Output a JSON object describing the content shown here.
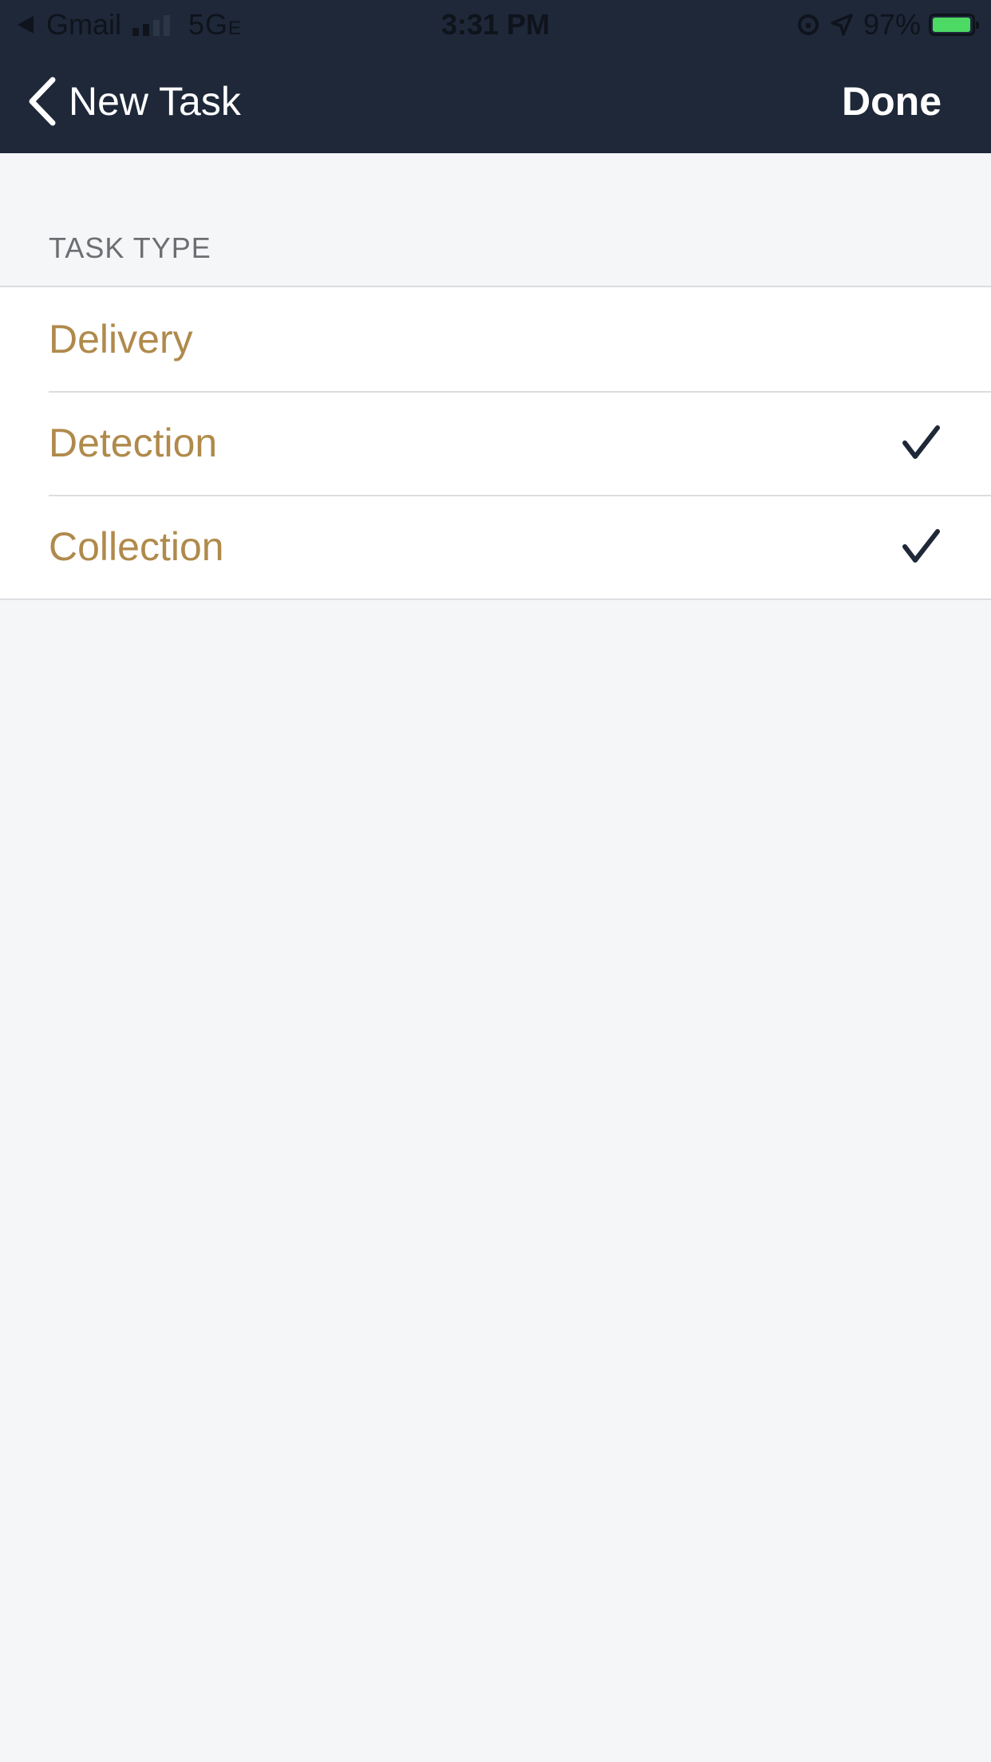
{
  "status_bar": {
    "back_app": "Gmail",
    "network": "5G",
    "network_suffix": "E",
    "time": "3:31 PM",
    "battery_percent": "97%",
    "battery_level": 0.97
  },
  "nav": {
    "back_label": "New Task",
    "done_label": "Done"
  },
  "section": {
    "header": "TASK TYPE"
  },
  "task_types": [
    {
      "label": "Delivery",
      "checked": false
    },
    {
      "label": "Detection",
      "checked": true
    },
    {
      "label": "Collection",
      "checked": true
    }
  ],
  "colors": {
    "nav_background": "#1e2839",
    "row_label": "#b08a4c",
    "checkmark": "#1e2839",
    "page_background": "#f5f6f8",
    "battery_fill": "#4cd964"
  }
}
